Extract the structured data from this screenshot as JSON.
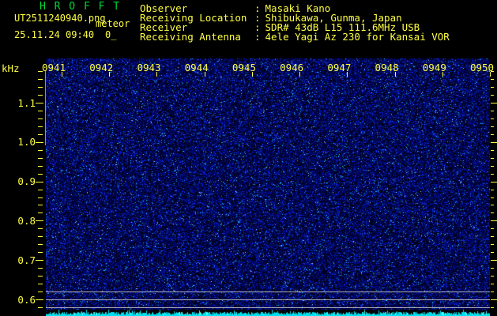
{
  "header": {
    "title": "H R O F F T",
    "filename": "UT2511240940.png",
    "overlay_label": "meteor",
    "datetime": "25.11.24 09:40",
    "echo_count": "0_",
    "separator": ":",
    "info": [
      {
        "label": "Observer",
        "value": "Masaki Kano"
      },
      {
        "label": "Receiving Location",
        "value": "Shibukawa, Gunma, Japan"
      },
      {
        "label": "Receiver",
        "value": "SDR# 43dB L15 111.6MHz USB"
      },
      {
        "label": "Receiving Antenna",
        "value": "4ele Yagi Az 230 for Kansai VOR"
      }
    ]
  },
  "chart_data": {
    "type": "heatmap",
    "subtype": "radio-meteor-spectrogram",
    "title": "HROFFT 10-minute spectrogram 0940-0950 UT",
    "ylabel": "kHz",
    "freq_ticks": [
      {
        "value": 1.1,
        "label": "1.1"
      },
      {
        "value": 1.0,
        "label": "1.0"
      },
      {
        "value": 0.9,
        "label": "0.9"
      },
      {
        "value": 0.8,
        "label": "0.8"
      },
      {
        "value": 0.7,
        "label": "0.7"
      },
      {
        "value": 0.6,
        "label": "0.6"
      }
    ],
    "freq_axis_range": [
      0.58,
      1.18
    ],
    "freq_minor_step": 0.02,
    "time_ticks": [
      "0941",
      "0942",
      "0943",
      "0944",
      "0945",
      "0946",
      "0947",
      "0948",
      "0949",
      "0950"
    ],
    "reference_line_freqs": [
      0.62,
      0.6,
      0.58
    ],
    "signal": "background noise floor only, no meteor echoes, echo count 0",
    "legend_position": "none",
    "grid": "off",
    "colors": {
      "text_yellow": "#ffff44",
      "title_green": "#00d833",
      "noise_blue": "#0000c8",
      "bright_cyan": "#00e8f8",
      "grid_gray": "#b0b0b8",
      "background": "#000000"
    }
  }
}
